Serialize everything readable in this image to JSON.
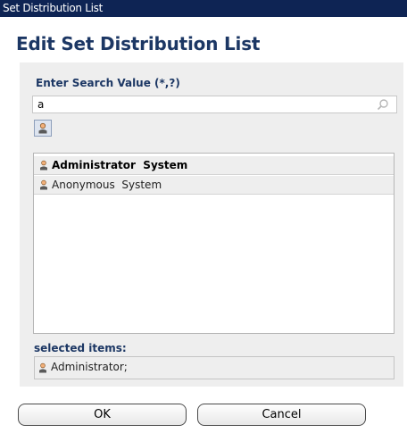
{
  "window": {
    "title": "Set Distribution List"
  },
  "page": {
    "heading": "Edit Set Distribution List"
  },
  "search": {
    "label": "Enter Search Value (*,?)",
    "value": "a"
  },
  "results": {
    "rows": [
      {
        "name": "Administrator  System",
        "selected": true
      },
      {
        "name": "Anonymous  System",
        "selected": false
      }
    ]
  },
  "selected": {
    "label": "selected items:",
    "value": "Administrator;"
  },
  "actions": {
    "ok_label": "OK",
    "cancel_label": "Cancel"
  },
  "icons": {
    "search": "magnifier-icon",
    "user": "user-icon"
  },
  "colors": {
    "titlebar": "#0e2454",
    "heading": "#1c3764",
    "panel": "#eeeeee"
  }
}
